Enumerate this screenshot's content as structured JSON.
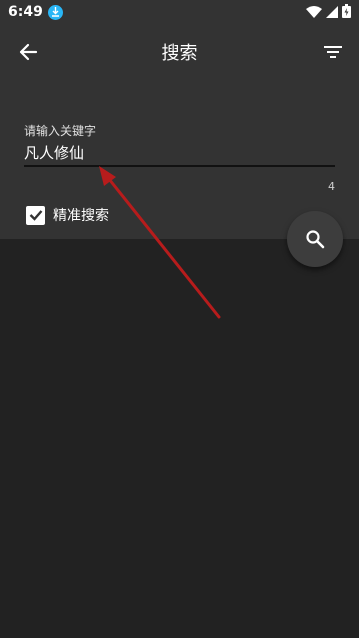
{
  "status_bar": {
    "time": "6:49",
    "icons": [
      "download-icon",
      "wifi-icon",
      "signal-icon",
      "battery-icon"
    ]
  },
  "toolbar": {
    "title": "搜索",
    "back_icon": "arrow-left-icon",
    "filter_icon": "filter-icon"
  },
  "search": {
    "label": "请输入关键字",
    "value": "凡人修仙",
    "char_count": "4"
  },
  "options": {
    "exact_label": "精准搜索",
    "exact_checked": true
  },
  "fab": {
    "icon": "search-icon"
  },
  "colors": {
    "background": "#222222",
    "panel": "#333333",
    "annotation_arrow": "#b71c1c",
    "download_badge": "#29b6f6"
  }
}
